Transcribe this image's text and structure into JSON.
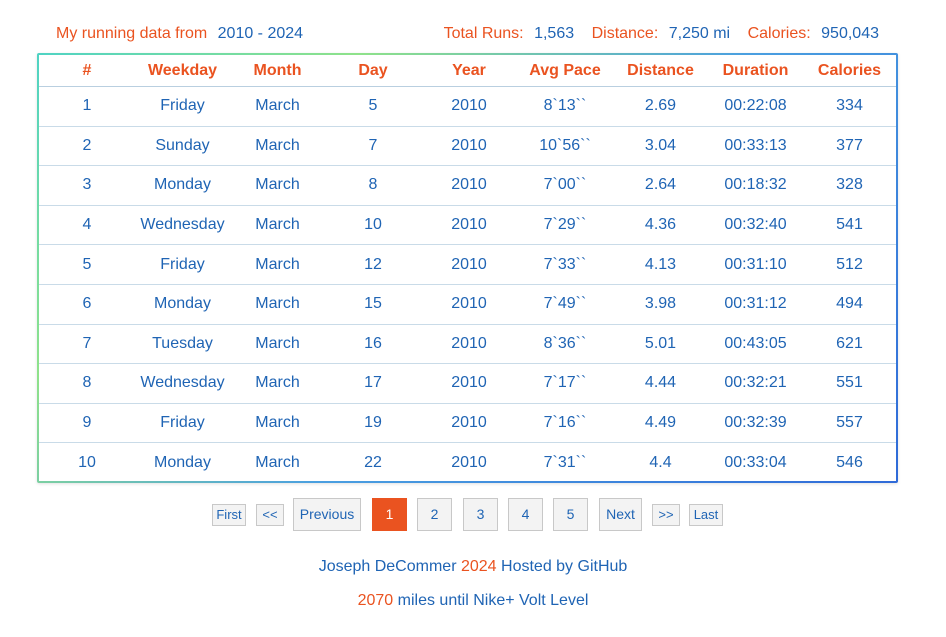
{
  "summary": {
    "label": "My running data from",
    "range": "2010 - 2024",
    "total_runs_label": "Total Runs:",
    "total_runs": "1,563",
    "distance_label": "Distance:",
    "distance": "7,250 mi",
    "calories_label": "Calories:",
    "calories": "950,043"
  },
  "table": {
    "headers": [
      "#",
      "Weekday",
      "Month",
      "Day",
      "Year",
      "Avg Pace",
      "Distance",
      "Duration",
      "Calories"
    ],
    "rows": [
      [
        "1",
        "Friday",
        "March",
        "5",
        "2010",
        "8`13``",
        "2.69",
        "00:22:08",
        "334"
      ],
      [
        "2",
        "Sunday",
        "March",
        "7",
        "2010",
        "10`56``",
        "3.04",
        "00:33:13",
        "377"
      ],
      [
        "3",
        "Monday",
        "March",
        "8",
        "2010",
        "7`00``",
        "2.64",
        "00:18:32",
        "328"
      ],
      [
        "4",
        "Wednesday",
        "March",
        "10",
        "2010",
        "7`29``",
        "4.36",
        "00:32:40",
        "541"
      ],
      [
        "5",
        "Friday",
        "March",
        "12",
        "2010",
        "7`33``",
        "4.13",
        "00:31:10",
        "512"
      ],
      [
        "6",
        "Monday",
        "March",
        "15",
        "2010",
        "7`49``",
        "3.98",
        "00:31:12",
        "494"
      ],
      [
        "7",
        "Tuesday",
        "March",
        "16",
        "2010",
        "8`36``",
        "5.01",
        "00:43:05",
        "621"
      ],
      [
        "8",
        "Wednesday",
        "March",
        "17",
        "2010",
        "7`17``",
        "4.44",
        "00:32:21",
        "551"
      ],
      [
        "9",
        "Friday",
        "March",
        "19",
        "2010",
        "7`16``",
        "4.49",
        "00:32:39",
        "557"
      ],
      [
        "10",
        "Monday",
        "March",
        "22",
        "2010",
        "7`31``",
        "4.4",
        "00:33:04",
        "546"
      ]
    ]
  },
  "pagination": {
    "first": "First",
    "prev_arrow": "<<",
    "previous": "Previous",
    "pages": [
      "1",
      "2",
      "3",
      "4",
      "5"
    ],
    "current_page": "1",
    "next": "Next",
    "next_arrow": ">>",
    "last": "Last"
  },
  "footer": {
    "author": "Joseph DeCommer",
    "year": "2024",
    "hosted": "Hosted by GitHub",
    "miles": "2070",
    "miles_text": "miles until Nike+ Volt Level"
  },
  "colors": {
    "accent": "#ea5320",
    "text_blue": "#1f64b4"
  }
}
